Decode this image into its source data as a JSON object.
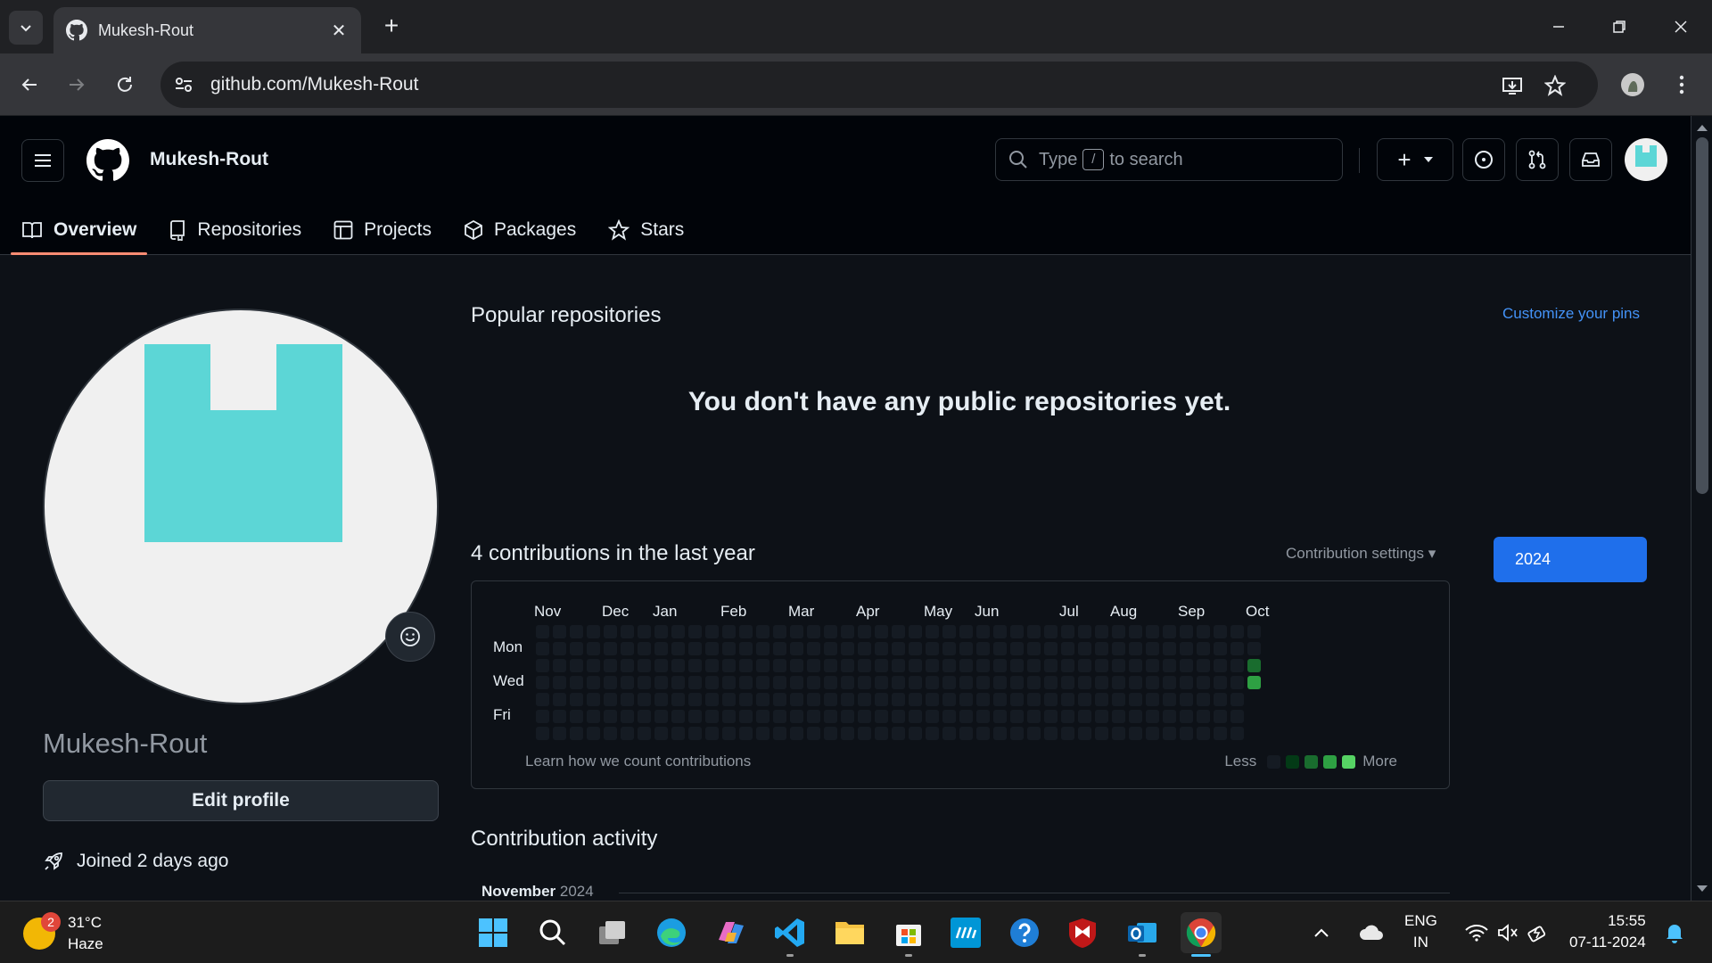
{
  "browser": {
    "tab_title": "Mukesh-Rout",
    "url": "github.com/Mukesh-Rout",
    "close_glyph": "✕",
    "new_tab_glyph": "+"
  },
  "header": {
    "username": "Mukesh-Rout",
    "search_before": "Type",
    "search_key": "/",
    "search_after": "to search",
    "create_glyph": "+"
  },
  "nav": {
    "items": [
      {
        "label": "Overview",
        "icon": "book-icon"
      },
      {
        "label": "Repositories",
        "icon": "repo-icon"
      },
      {
        "label": "Projects",
        "icon": "table-icon"
      },
      {
        "label": "Packages",
        "icon": "package-icon"
      },
      {
        "label": "Stars",
        "icon": "star-icon"
      }
    ]
  },
  "profile": {
    "name": "Mukesh-Rout",
    "edit_label": "Edit profile",
    "joined": "Joined 2 days ago"
  },
  "popular": {
    "title": "Popular repositories",
    "customize": "Customize your pins",
    "empty": "You don't have any public repositories yet."
  },
  "contributions": {
    "title": "4 contributions in the last year",
    "settings": "Contribution settings ▾",
    "year": "2024",
    "months": [
      "Nov",
      "Dec",
      "Jan",
      "Feb",
      "Mar",
      "Apr",
      "May",
      "Jun",
      "Jul",
      "Aug",
      "Sep",
      "Oct"
    ],
    "days": [
      "Mon",
      "Wed",
      "Fri"
    ],
    "footer": "Learn how we count contributions",
    "legend_less": "Less",
    "legend_more": "More",
    "legend_colors": [
      "#151b23",
      "#033a16",
      "#196c2e",
      "#2ea043",
      "#56d364"
    ],
    "colors": {
      "empty": "#151b23",
      "level2": "#196c2e",
      "level3": "#2ea043"
    }
  },
  "activity": {
    "title": "Contribution activity",
    "month": "November",
    "year": "2024"
  },
  "taskbar": {
    "temp": "31°C",
    "condition": "Haze",
    "badge": "2",
    "lang1": "ENG",
    "lang2": "IN",
    "time": "15:55",
    "date": "07-11-2024"
  }
}
